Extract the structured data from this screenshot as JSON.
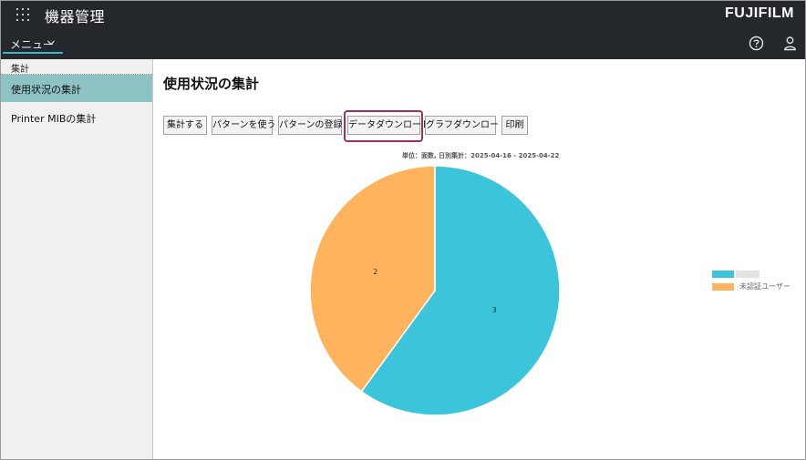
{
  "header": {
    "app_title": "機器管理",
    "brand": "FUJIFILM",
    "menu_label": "メニュー",
    "icons": [
      "apps-grid-icon",
      "chevron-down-icon",
      "help-circle-icon",
      "user-icon"
    ]
  },
  "sidebar": {
    "section_label": "集計",
    "items": [
      {
        "label": "使用状況の集計",
        "active": true
      },
      {
        "label": "Printer MIBの集計",
        "active": false
      }
    ]
  },
  "main": {
    "title": "使用状況の集計",
    "buttons": [
      {
        "label": "集計する"
      },
      {
        "label": "パターンを使う"
      },
      {
        "label": "パターンの登録"
      },
      {
        "label": "データダウンロード",
        "highlighted": true
      },
      {
        "label": "グラフダウンロード"
      },
      {
        "label": "印刷"
      }
    ]
  },
  "colors": {
    "topbar": "#24272b",
    "accent": "#3bb6cc",
    "sidebar_active": "#8ec3c6",
    "highlight_border": "#a12e62"
  },
  "chart_data": {
    "type": "pie",
    "subtitle": "単位：面数, 日別集計：2025-04-16 - 2025-04-22",
    "categories": [
      "",
      "未認証ユーザー"
    ],
    "values": [
      3,
      2
    ],
    "colors": [
      "#3cc4da",
      "#ffb35c"
    ],
    "legend_position": "right"
  }
}
